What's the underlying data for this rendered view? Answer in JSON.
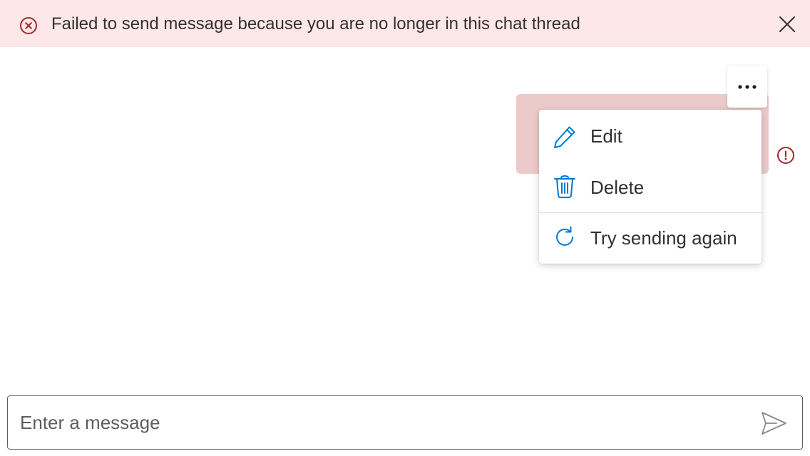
{
  "banner": {
    "message": "Failed to send message because you are no longer in this chat thread",
    "error_icon": "error-circle-icon",
    "close_icon": "close-icon"
  },
  "message": {
    "status_icon": "alert-circle-icon",
    "more_icon": "more-horizontal-icon"
  },
  "context_menu": {
    "items": [
      {
        "label": "Edit",
        "icon": "pencil-icon"
      },
      {
        "label": "Delete",
        "icon": "trash-icon"
      },
      {
        "label": "Try sending again",
        "icon": "retry-icon"
      }
    ]
  },
  "composer": {
    "placeholder": "Enter a message",
    "value": "",
    "send_icon": "send-icon"
  },
  "colors": {
    "banner_bg": "#fde7e9",
    "error_red": "#a4262c",
    "failed_bubble": "#eccaca",
    "accent_blue": "#0078d4",
    "text": "#323130"
  }
}
